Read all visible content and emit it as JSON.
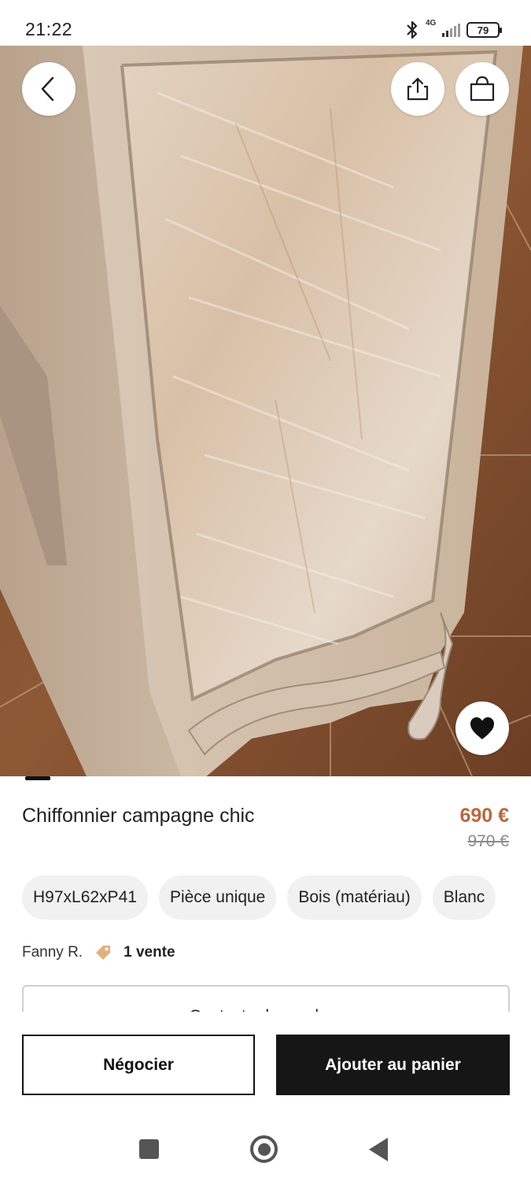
{
  "status_bar": {
    "time": "21:22",
    "network": "4G",
    "battery": "79",
    "icons": [
      "bluetooth-icon",
      "signal-icon",
      "battery-icon"
    ]
  },
  "header": {
    "back_icon": "chevron-left-icon",
    "share_icon": "share-icon",
    "cart_icon": "shopping-bag-icon"
  },
  "favorite_icon": "heart-icon",
  "product": {
    "title": "Chiffonnier campagne chic",
    "price": "690 €",
    "old_price": "970 €",
    "chips": [
      "H97xL62xP41",
      "Pièce unique",
      "Bois (matériau)",
      "Blanc"
    ]
  },
  "seller": {
    "name": "Fanny R.",
    "sales": "1 vente",
    "tag_icon": "price-tag-icon"
  },
  "contact_button": "Contacter le vendeur",
  "actions": {
    "negotiate": "Négocier",
    "add_to_cart": "Ajouter au panier"
  },
  "colors": {
    "price": "#b9683e",
    "primary_button": "#161616"
  }
}
